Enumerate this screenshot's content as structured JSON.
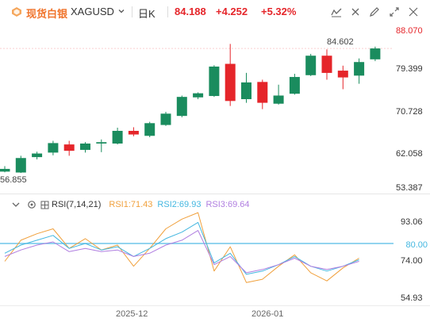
{
  "toolbar": {
    "symbol_cn": "现货白银",
    "symbol_code": "XAGUSD",
    "interval": "日K",
    "price": "84.188",
    "change": "+4.252",
    "change_pct": "+5.32%"
  },
  "price_axis": {
    "labels": [
      "88.070",
      "79.399",
      "70.728",
      "62.058",
      "53.387"
    ],
    "current_price": "88.070",
    "current_price_color": "#e5252a",
    "high_label": "84.602",
    "low_label": "56.855"
  },
  "rsi_panel": {
    "title": "RSI(7,14,21)",
    "rsi1_label": "RSI1:71.43",
    "rsi2_label": "RSI2:69.93",
    "rsi3_label": "RSI3:69.64",
    "axis_labels": [
      "93.06",
      "74.00",
      "54.93"
    ],
    "overbought_label": "80.00"
  },
  "x_axis": {
    "labels": [
      "2025-12",
      "2026-01"
    ]
  },
  "colors": {
    "up": "#1a8c5e",
    "down": "#e5252a",
    "rsi1": "#f0a03c",
    "rsi2": "#44b7e0",
    "rsi3": "#b07ee0",
    "overbought_line": "#6ec6ea"
  },
  "icons": [
    "silver-logo-icon",
    "dropdown-icon",
    "line-tool-icon",
    "cross-icon",
    "pencil-icon",
    "fullscreen-icon",
    "collapse-icon",
    "eye-icon",
    "settings-icon",
    "grid-icon"
  ],
  "chart_data": [
    {
      "type": "candlestick",
      "title": "",
      "ylim": [
        53.387,
        88.07
      ],
      "candles": [
        {
          "o": 57.0,
          "h": 58.2,
          "l": 56.855,
          "c": 57.6
        },
        {
          "o": 56.8,
          "h": 60.5,
          "l": 56.7,
          "c": 60.0
        },
        {
          "o": 60.2,
          "h": 61.4,
          "l": 59.7,
          "c": 61.0
        },
        {
          "o": 61.2,
          "h": 63.8,
          "l": 60.6,
          "c": 63.3
        },
        {
          "o": 63.0,
          "h": 63.8,
          "l": 60.5,
          "c": 61.6
        },
        {
          "o": 61.8,
          "h": 63.5,
          "l": 61.2,
          "c": 63.2
        },
        {
          "o": 63.2,
          "h": 64.1,
          "l": 61.3,
          "c": 63.5
        },
        {
          "o": 63.2,
          "h": 66.7,
          "l": 63.0,
          "c": 66.0
        },
        {
          "o": 66.0,
          "h": 66.8,
          "l": 64.8,
          "c": 65.2
        },
        {
          "o": 64.9,
          "h": 68.0,
          "l": 64.6,
          "c": 67.7
        },
        {
          "o": 67.3,
          "h": 70.2,
          "l": 67.1,
          "c": 69.8
        },
        {
          "o": 69.3,
          "h": 73.8,
          "l": 69.0,
          "c": 73.5
        },
        {
          "o": 73.4,
          "h": 74.5,
          "l": 73.0,
          "c": 74.3
        },
        {
          "o": 73.7,
          "h": 80.5,
          "l": 73.5,
          "c": 80.2
        },
        {
          "o": 80.8,
          "h": 85.2,
          "l": 71.5,
          "c": 72.6
        },
        {
          "o": 73.0,
          "h": 78.8,
          "l": 72.2,
          "c": 76.7
        },
        {
          "o": 76.8,
          "h": 77.3,
          "l": 70.8,
          "c": 72.2
        },
        {
          "o": 72.0,
          "h": 76.2,
          "l": 71.8,
          "c": 73.8
        },
        {
          "o": 74.2,
          "h": 78.6,
          "l": 74.0,
          "c": 77.9
        },
        {
          "o": 78.3,
          "h": 83.0,
          "l": 78.1,
          "c": 82.6
        },
        {
          "o": 82.6,
          "h": 84.0,
          "l": 77.3,
          "c": 78.8
        },
        {
          "o": 79.3,
          "h": 80.4,
          "l": 75.2,
          "c": 77.8
        },
        {
          "o": 78.2,
          "h": 82.0,
          "l": 76.4,
          "c": 81.2
        },
        {
          "o": 81.8,
          "h": 84.602,
          "l": 81.4,
          "c": 84.2
        }
      ]
    },
    {
      "type": "line",
      "title": "RSI(7,14,21)",
      "ylim": [
        50,
        100
      ],
      "series": [
        {
          "name": "RSI1",
          "color": "#f0a03c",
          "values": [
            69,
            82,
            86,
            89,
            77,
            83,
            76,
            79,
            66,
            77,
            89,
            95,
            99,
            63,
            78,
            56,
            58,
            66,
            73,
            62,
            57,
            65,
            71
          ]
        },
        {
          "name": "RSI2",
          "color": "#44b7e0",
          "values": [
            74,
            79,
            82,
            85,
            77,
            80,
            76,
            78,
            72,
            77,
            83,
            87,
            93,
            68,
            74,
            61,
            63,
            67,
            72,
            66,
            63,
            66,
            70
          ]
        },
        {
          "name": "RSI3",
          "color": "#b07ee0",
          "values": [
            72,
            76,
            79,
            81,
            75,
            77,
            75,
            76,
            72,
            74,
            79,
            82,
            88,
            67,
            72,
            62,
            64,
            67,
            71,
            66,
            64,
            66,
            69
          ]
        }
      ],
      "hlines": [
        80
      ]
    }
  ]
}
